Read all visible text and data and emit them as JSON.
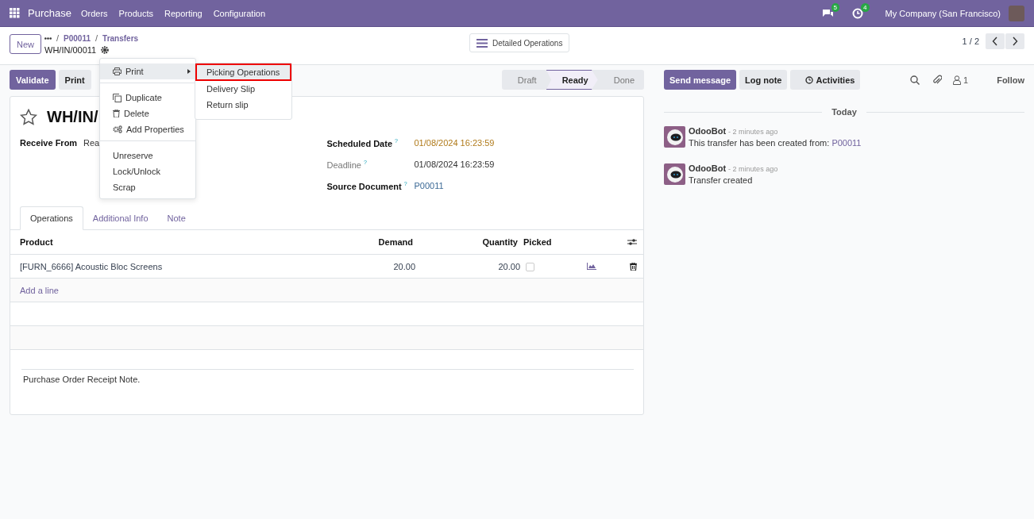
{
  "navbar": {
    "app_name": "Purchase",
    "menu": [
      "Orders",
      "Products",
      "Reporting",
      "Configuration"
    ],
    "messages_badge": "5",
    "activities_badge": "4",
    "company": "My Company (San Francisco)"
  },
  "control_panel": {
    "new_button": "New",
    "breadcrumbs": [
      {
        "separator": "/",
        "label": "P00011"
      },
      {
        "separator": "/",
        "label": "Transfers"
      }
    ],
    "record": "WH/IN/00011",
    "detailed_operations": "Detailed Operations",
    "pager": "1 / 2"
  },
  "action_buttons": [
    {
      "label": "Validate",
      "primary": true
    },
    {
      "label": "Print",
      "primary": false
    }
  ],
  "statusbar": [
    {
      "label": "Draft",
      "selected": false
    },
    {
      "label": "Ready",
      "selected": true
    },
    {
      "label": "Done",
      "selected": false
    }
  ],
  "form": {
    "title": "WH/IN/",
    "left_fields": [
      {
        "label": "Receive From",
        "value": "Rea",
        "kind": "plain"
      }
    ],
    "right_fields": [
      {
        "label": "Scheduled Date",
        "help": "?",
        "value": "01/08/2024 16:23:59",
        "kind": "warning"
      },
      {
        "label": "Deadline",
        "help": "?",
        "value": "01/08/2024 16:23:59",
        "kind": "muted"
      },
      {
        "label": "Source Document",
        "help": "?",
        "value": "P00011",
        "kind": "reference"
      }
    ]
  },
  "tabs": [
    {
      "label": "Operations",
      "selected": true
    },
    {
      "label": "Additional Info",
      "selected": false
    },
    {
      "label": "Note",
      "selected": false
    }
  ],
  "table": {
    "columns": [
      "Product",
      "Demand",
      "Quantity",
      "Picked"
    ],
    "rows": [
      {
        "product": "[FURN_6666] Acoustic Bloc Screens",
        "demand": "20.00",
        "quantity": "20.00",
        "picked": false
      }
    ],
    "add_line": "Add a line"
  },
  "note": "Purchase Order Receipt Note.",
  "chatter": {
    "buttons": [
      {
        "label": "Send message",
        "primary": true,
        "kind": "text"
      },
      {
        "label": "Log note",
        "primary": false,
        "kind": "text"
      },
      {
        "label": "Activities",
        "primary": false,
        "kind": "clock"
      }
    ],
    "followers": "1",
    "follow": "Follow",
    "separator": "Today",
    "messages": [
      {
        "author": "OdooBot",
        "time": "- 2 minutes ago",
        "body": "This transfer has been created from: ",
        "link": "P00011"
      },
      {
        "author": "OdooBot",
        "time": "- 2 minutes ago",
        "body": "Transfer created"
      }
    ]
  },
  "action_menu": {
    "sections": [
      [
        {
          "label": "Print",
          "kind": "print",
          "submenu": true,
          "selected": true
        }
      ],
      [
        {
          "label": "Duplicate",
          "kind": "duplicate",
          "submenu": false,
          "selected": false
        },
        {
          "label": "Delete",
          "kind": "delete",
          "submenu": false,
          "selected": false
        },
        {
          "label": "Add Properties",
          "kind": "properties",
          "submenu": false,
          "selected": false
        }
      ],
      [
        {
          "label": "Unreserve",
          "kind": "plain",
          "submenu": false,
          "selected": false
        },
        {
          "label": "Lock/Unlock",
          "kind": "plain",
          "submenu": false,
          "selected": false
        },
        {
          "label": "Scrap",
          "kind": "plain",
          "submenu": false,
          "selected": false
        }
      ]
    ],
    "submenu": [
      {
        "label": "Picking Operations",
        "selected": true
      },
      {
        "label": "Delivery Slip",
        "selected": false
      },
      {
        "label": "Return slip",
        "selected": false
      }
    ]
  }
}
